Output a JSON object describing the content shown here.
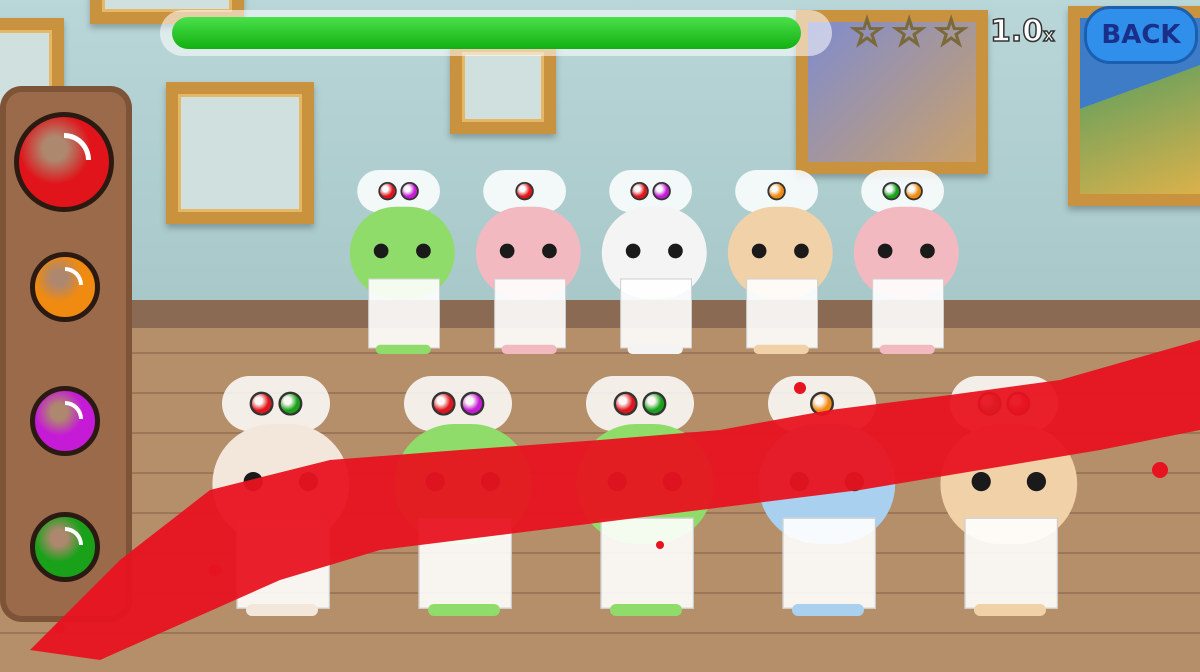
{
  "hud": {
    "progress": 0.97,
    "stars_total": 3,
    "speed_label": "1.0",
    "speed_suffix": "x",
    "back_label": "BACK"
  },
  "colors": {
    "red": "#e0141a",
    "orange": "#f08a10",
    "purple": "#c51ad6",
    "green": "#1aa11a",
    "splatter": "#e81320"
  },
  "color_buttons": [
    {
      "name": "red",
      "color": "#e0141a",
      "selected": true
    },
    {
      "name": "orange",
      "color": "#f08a10",
      "selected": false
    },
    {
      "name": "purple",
      "color": "#c51ad6",
      "selected": false
    },
    {
      "name": "green",
      "color": "#1aa11a",
      "selected": false
    }
  ],
  "back_row": [
    {
      "animal": "frog",
      "order": [
        "red",
        "purple"
      ]
    },
    {
      "animal": "octopus",
      "order": [
        "red"
      ]
    },
    {
      "animal": "husky",
      "order": [
        "red",
        "purple"
      ]
    },
    {
      "animal": "cat",
      "order": [
        "orange"
      ]
    },
    {
      "animal": "octopus",
      "order": [
        "green",
        "orange"
      ]
    }
  ],
  "front_row": [
    {
      "animal": "puppy",
      "order": [
        "red",
        "green"
      ]
    },
    {
      "animal": "frog",
      "order": [
        "red",
        "purple"
      ]
    },
    {
      "animal": "frog",
      "order": [
        "red",
        "green"
      ]
    },
    {
      "animal": "bird",
      "order": [
        "orange"
      ]
    },
    {
      "animal": "cat",
      "order": [
        "green",
        "red"
      ]
    }
  ]
}
